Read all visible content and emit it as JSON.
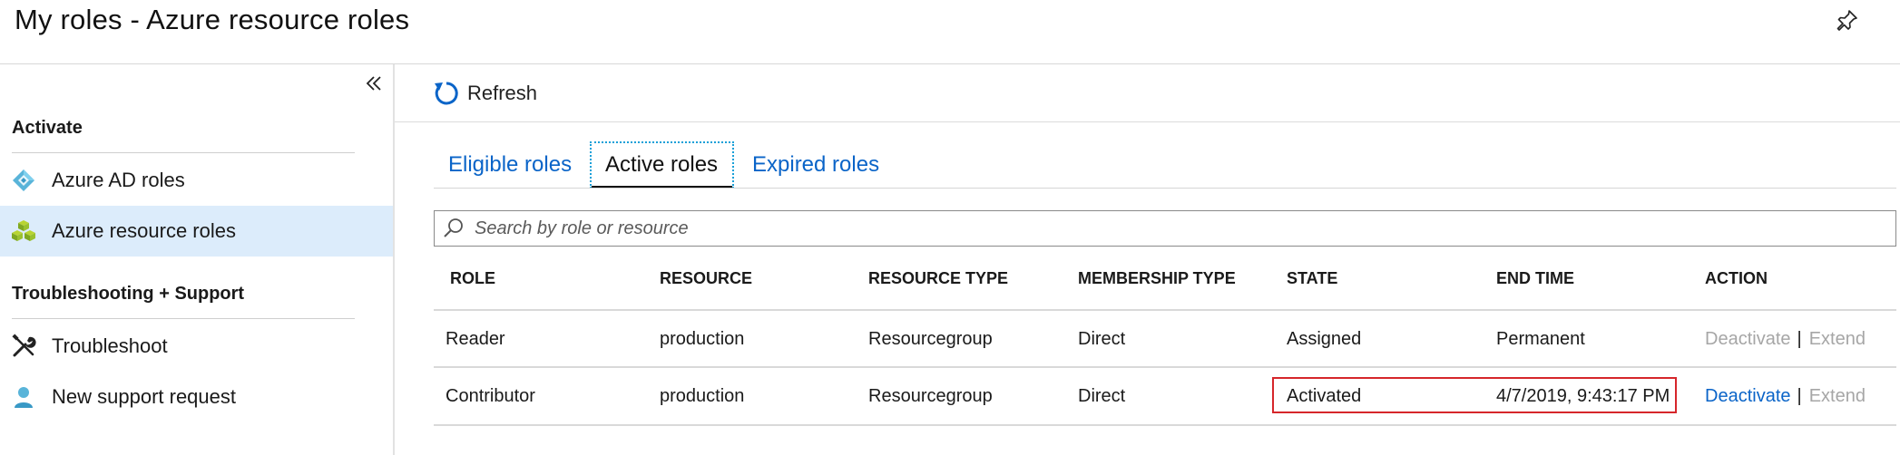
{
  "page": {
    "title": "My roles - Azure resource roles"
  },
  "sidebar": {
    "sections": [
      {
        "title": "Activate",
        "items": [
          {
            "label": "Azure AD roles",
            "icon": "azure-ad-diamond-icon",
            "selected": false
          },
          {
            "label": "Azure resource roles",
            "icon": "azure-resource-cubes-icon",
            "selected": true
          }
        ]
      },
      {
        "title": "Troubleshooting + Support",
        "items": [
          {
            "label": "Troubleshoot",
            "icon": "tools-icon",
            "selected": false
          },
          {
            "label": "New support request",
            "icon": "support-person-icon",
            "selected": false
          }
        ]
      }
    ]
  },
  "toolbar": {
    "refresh_label": "Refresh"
  },
  "tabs": [
    {
      "label": "Eligible roles",
      "active": false
    },
    {
      "label": "Active roles",
      "active": true
    },
    {
      "label": "Expired roles",
      "active": false
    }
  ],
  "search": {
    "placeholder": "Search by role or resource",
    "value": ""
  },
  "table": {
    "columns": [
      "ROLE",
      "RESOURCE",
      "RESOURCE TYPE",
      "MEMBERSHIP TYPE",
      "STATE",
      "END TIME",
      "ACTION"
    ],
    "rows": [
      {
        "role": "Reader",
        "resource": "production",
        "resource_type": "Resourcegroup",
        "membership_type": "Direct",
        "state": "Assigned",
        "end_time": "Permanent",
        "actions": {
          "deactivate": "Deactivate",
          "deactivate_enabled": false,
          "separator": "|",
          "extend": "Extend",
          "extend_enabled": false
        }
      },
      {
        "role": "Contributor",
        "resource": "production",
        "resource_type": "Resourcegroup",
        "membership_type": "Direct",
        "state": "Activated",
        "end_time": "4/7/2019, 9:43:17 PM",
        "actions": {
          "deactivate": "Deactivate",
          "deactivate_enabled": true,
          "separator": "|",
          "extend": "Extend",
          "extend_enabled": false
        }
      }
    ]
  },
  "colors": {
    "link": "#0a64c8",
    "disabled": "#a6a6a6",
    "selected_bg": "#dcecfb",
    "highlight": "#d6262b"
  }
}
